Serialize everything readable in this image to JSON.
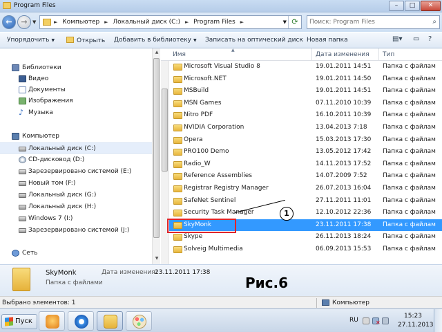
{
  "window": {
    "title": "Program Files",
    "controls": {
      "minimize": "–",
      "maximize": "□",
      "close": "✕"
    }
  },
  "address": {
    "crumbs": [
      "Компьютер",
      "Локальный диск (C:)",
      "Program Files"
    ],
    "search_placeholder": "Поиск: Program Files"
  },
  "toolbar": {
    "organize": "Упорядочить",
    "open": "Открыть",
    "add_to_library": "Добавить в библиотеку",
    "burn": "Записать на оптический диск",
    "new_folder": "Новая папка"
  },
  "nav": {
    "libraries": "Библиотеки",
    "lib_items": [
      "Видео",
      "Документы",
      "Изображения",
      "Музыка"
    ],
    "computer": "Компьютер",
    "drives": [
      "Локальный диск (C:)",
      "CD-дисковод (D:)",
      "Зарезервировано системой (E:)",
      "Новый том (F:)",
      "Локальный диск (G:)",
      "Локальный диск (H:)",
      "Windows 7 (I:)",
      "Зарезервировано системой (J:)"
    ],
    "network": "Сеть"
  },
  "columns": {
    "name": "Имя",
    "date": "Дата изменения",
    "type": "Тип"
  },
  "files": [
    {
      "name": "Microsoft Visual Studio 8",
      "date": "19.01.2011 14:51",
      "type": "Папка с файлам"
    },
    {
      "name": "Microsoft.NET",
      "date": "19.01.2011 14:50",
      "type": "Папка с файлам"
    },
    {
      "name": "MSBuild",
      "date": "19.01.2011 14:51",
      "type": "Папка с файлам"
    },
    {
      "name": "MSN Games",
      "date": "07.11.2010 10:39",
      "type": "Папка с файлам"
    },
    {
      "name": "Nitro PDF",
      "date": "16.10.2011 10:39",
      "type": "Папка с файлам"
    },
    {
      "name": "NVIDIA Corporation",
      "date": "13.04.2013 7:18",
      "type": "Папка с файлам"
    },
    {
      "name": "Opera",
      "date": "15.03.2013 17:30",
      "type": "Папка с файлам"
    },
    {
      "name": "PRO100 Demo",
      "date": "13.05.2012 17:42",
      "type": "Папка с файлам"
    },
    {
      "name": "Radio_W",
      "date": "14.11.2013 17:52",
      "type": "Папка с файлам"
    },
    {
      "name": "Reference Assemblies",
      "date": "14.07.2009 7:52",
      "type": "Папка с файлам"
    },
    {
      "name": "Registrar Registry Manager",
      "date": "26.07.2013 16:04",
      "type": "Папка с файлам"
    },
    {
      "name": "SafeNet Sentinel",
      "date": "27.11.2011 11:01",
      "type": "Папка с файлам"
    },
    {
      "name": "Security Task Manager",
      "date": "12.10.2012 22:36",
      "type": "Папка с файлам"
    },
    {
      "name": "SkyMonk",
      "date": "23.11.2011 17:38",
      "type": "Папка с файлам"
    },
    {
      "name": "Skype",
      "date": "26.11.2013 18:24",
      "type": "Папка с файлам"
    },
    {
      "name": "Solveig Multimedia",
      "date": "06.09.2013 15:53",
      "type": "Папка с файлам"
    }
  ],
  "selected_index": 13,
  "callout": "1",
  "details": {
    "name": "SkyMonk",
    "type": "Папка с файлами",
    "date_label": "Дата изменения:",
    "date": "23.11.2011 17:38"
  },
  "figure_label": "Рис.6",
  "status": {
    "selected": "Выбрано элементов: 1",
    "location": "Компьютер"
  },
  "taskbar": {
    "start": "Пуск",
    "lang": "RU",
    "time": "15:23",
    "date": "27.11.2013"
  },
  "colors": {
    "selection": "#3399ff",
    "callout_box": "#e0242a"
  }
}
